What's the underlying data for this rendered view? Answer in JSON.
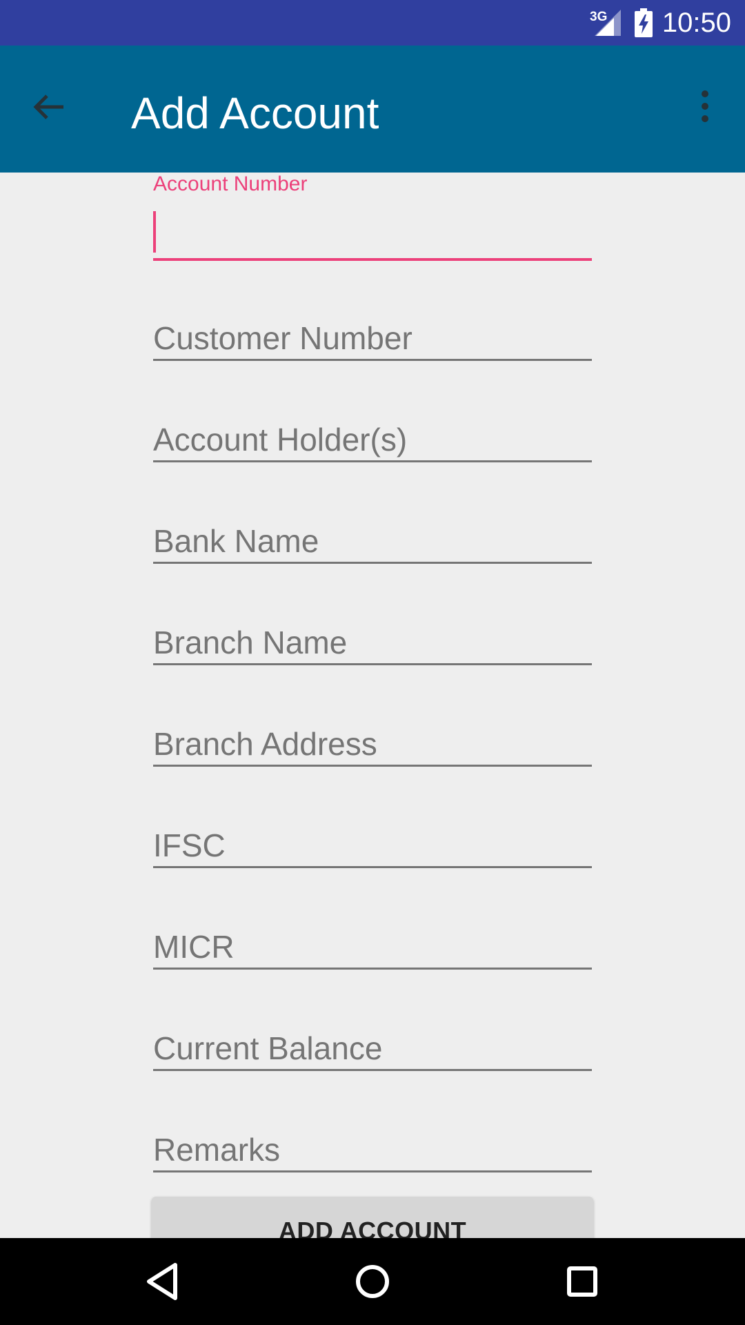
{
  "status_bar": {
    "network": "3G",
    "time": "10:50",
    "icons": [
      "signal-icon",
      "battery-charging-icon"
    ]
  },
  "app_bar": {
    "title": "Add Account",
    "back_icon": "arrow-back-icon",
    "menu_icon": "more-vert-icon"
  },
  "form": {
    "fields": [
      {
        "label": "Account Number",
        "value": "",
        "focused": true
      },
      {
        "label": "Customer Number",
        "value": ""
      },
      {
        "label": "Account Holder(s)",
        "value": ""
      },
      {
        "label": "Bank Name",
        "value": ""
      },
      {
        "label": "Branch Name",
        "value": ""
      },
      {
        "label": "Branch Address",
        "value": ""
      },
      {
        "label": "IFSC",
        "value": ""
      },
      {
        "label": "MICR",
        "value": ""
      },
      {
        "label": "Current Balance",
        "value": ""
      },
      {
        "label": "Remarks",
        "value": ""
      }
    ],
    "submit_label": "ADD ACCOUNT"
  },
  "nav_bar": {
    "icons": [
      "nav-back-icon",
      "nav-home-icon",
      "nav-recents-icon"
    ]
  },
  "colors": {
    "status_bar": "#303f9f",
    "app_bar": "#006691",
    "accent": "#ec407a",
    "background": "#eeeeee"
  }
}
